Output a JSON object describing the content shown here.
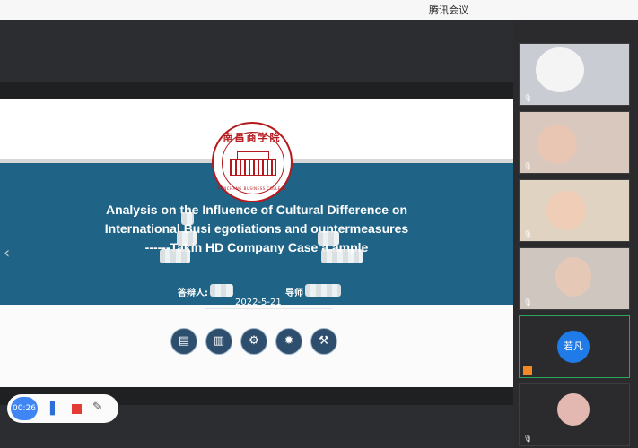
{
  "app": {
    "title": "腾讯会议"
  },
  "slide": {
    "logo_text": "南昌商学院",
    "logo_caption": "NANCHANG BUSINESS COLLEGE",
    "title_lines": [
      "Analysis on the Influence of Cultural Difference on",
      "International Busi      egotiations and      ountermeasures",
      "------Takin      HD Company Case a      ample"
    ],
    "presenter_label": "答辩人:",
    "advisor_label": "导师",
    "date": "2022-5-21",
    "nav_prev": "‹"
  },
  "toolbar_icons": [
    {
      "name": "document-icon",
      "glyph": "▤"
    },
    {
      "name": "building-icon",
      "glyph": "▥"
    },
    {
      "name": "gears-icon",
      "glyph": "⚙"
    },
    {
      "name": "lightbulb-icon",
      "glyph": "✹"
    },
    {
      "name": "gavel-icon",
      "glyph": "⚒"
    }
  ],
  "recorder": {
    "time": "00:26",
    "pen_icon": "pen-icon",
    "stop_icon": "stop-icon",
    "pencil_icon": "pencil-icon"
  },
  "participants": [
    {
      "name": "",
      "kind": "video",
      "mic": "muted",
      "bg": "#c9cdd3"
    },
    {
      "name": "",
      "kind": "video",
      "mic": "muted",
      "bg": "#d8c8bd"
    },
    {
      "name": "",
      "kind": "video",
      "mic": "muted",
      "bg": "#e1d3c1"
    },
    {
      "name": "",
      "kind": "video",
      "mic": "muted",
      "bg": "#cfc6c0"
    },
    {
      "name": "若凡",
      "kind": "avatar",
      "avatar_text": "若凡",
      "mic": "off",
      "bg": "#2b2b2d",
      "avatar_color": "#1f7be8"
    },
    {
      "name": "",
      "kind": "avatar",
      "mic": "off",
      "bg": "#2b2b2d"
    }
  ]
}
